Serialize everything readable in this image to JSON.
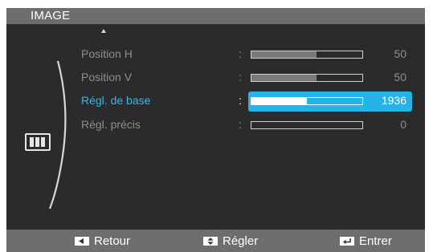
{
  "menu": {
    "title": "IMAGE",
    "category_icon": "picture-size-icon"
  },
  "settings": [
    {
      "label": "Position H",
      "value": "50",
      "level_percent": 59,
      "selected": false
    },
    {
      "label": "Position V",
      "value": "50",
      "level_percent": 59,
      "selected": false
    },
    {
      "label": "Régl. de base",
      "value": "1936",
      "level_percent": 50,
      "selected": true
    },
    {
      "label": "Régl. précis",
      "value": "0",
      "level_percent": 0,
      "selected": false
    }
  ],
  "separator": ":",
  "footer": {
    "back_label": "Retour",
    "back_icon": "left-arrow-key-icon",
    "adjust_label": "Régler",
    "adjust_icon": "up-down-key-icon",
    "enter_label": "Entrer",
    "enter_icon": "enter-key-icon"
  },
  "colors": {
    "highlight": "#26b3e8",
    "panel": "#2b2b2b",
    "bar_gray": "#6e6e6e"
  }
}
